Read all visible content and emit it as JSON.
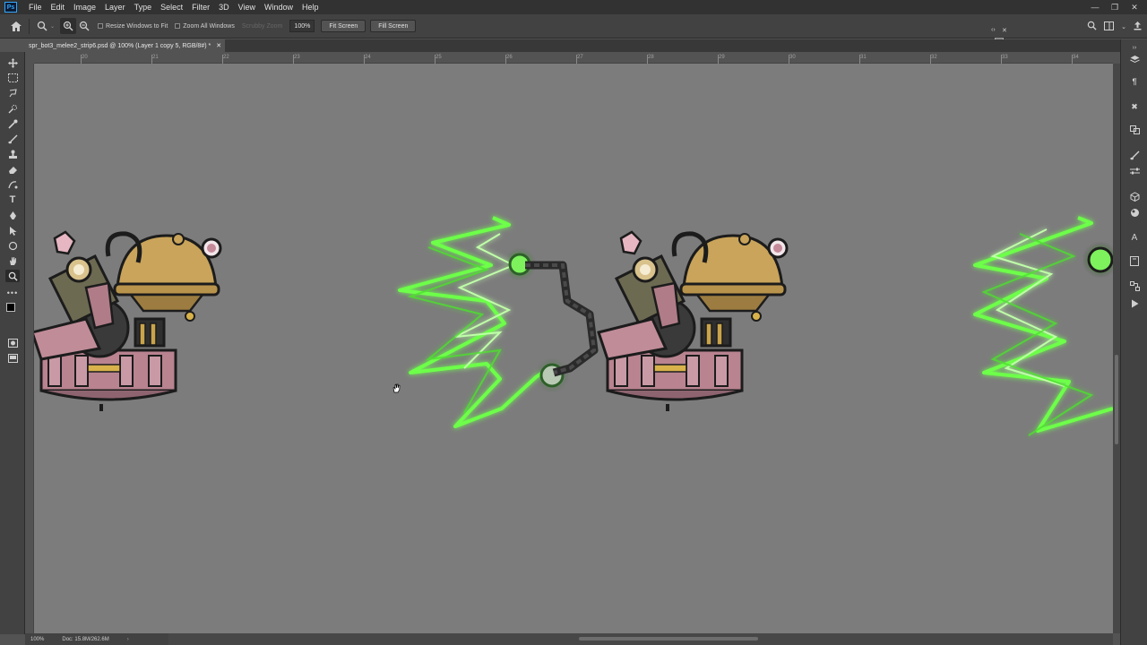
{
  "app": {
    "logo": "Ps",
    "menu": [
      "File",
      "Edit",
      "Image",
      "Layer",
      "Type",
      "Select",
      "Filter",
      "3D",
      "View",
      "Window",
      "Help"
    ]
  },
  "options": {
    "resize_windows": "Resize Windows to Fit",
    "zoom_all": "Zoom All Windows",
    "scrubby_zoom": "Scrubby Zoom",
    "zoom_value": "100%",
    "fit_screen": "Fit Screen",
    "fill_screen": "Fill Screen"
  },
  "document": {
    "tab_title": "spr_bot3_melee2_strip6.psd @ 100% (Layer 1 copy 5, RGB/8#) *"
  },
  "ruler": {
    "ticks": [
      "20",
      "21",
      "22",
      "23",
      "24",
      "25",
      "26",
      "27",
      "28",
      "29",
      "30",
      "31",
      "32",
      "33",
      "34"
    ]
  },
  "status": {
    "zoom": "100%",
    "doc_size": "Doc: 15.8M/262.6M"
  },
  "colors": {
    "lightning": "#6dff4a",
    "canvas": "#7c7c7c",
    "accent": "#31a8ff"
  },
  "icons": {
    "home": "home-icon",
    "zoom_tool": "zoom-icon",
    "search": "search-icon"
  }
}
